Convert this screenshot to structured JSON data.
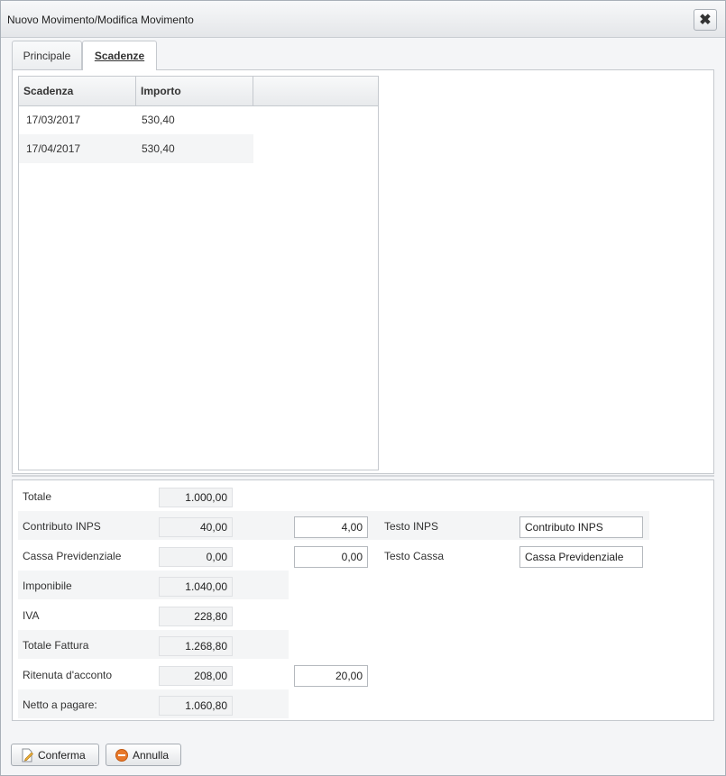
{
  "dialog": {
    "title": "Nuovo Movimento/Modifica Movimento"
  },
  "tabs": [
    {
      "label": "Principale",
      "active": false
    },
    {
      "label": "Scadenze",
      "active": true
    }
  ],
  "scadenze": {
    "headers": [
      "Scadenza",
      "Importo"
    ],
    "rows": [
      {
        "scadenza": "17/03/2017",
        "importo": "530,40"
      },
      {
        "scadenza": "17/04/2017",
        "importo": "530,40"
      }
    ]
  },
  "summary": {
    "totale": {
      "label": "Totale",
      "value": "1.000,00"
    },
    "contributo_inps": {
      "label": "Contributo INPS",
      "value": "40,00",
      "percent": "4,00",
      "text_label": "Testo INPS",
      "text_value": "Contributo INPS"
    },
    "cassa_previdenziale": {
      "label": "Cassa Previdenziale",
      "value": "0,00",
      "percent": "0,00",
      "text_label": "Testo Cassa",
      "text_value": "Cassa Previdenziale"
    },
    "imponibile": {
      "label": "Imponibile",
      "value": "1.040,00"
    },
    "iva": {
      "label": "IVA",
      "value": "228,80"
    },
    "totale_fattura": {
      "label": "Totale Fattura",
      "value": "1.268,80"
    },
    "ritenuta": {
      "label": "Ritenuta d'acconto",
      "value": "208,00",
      "percent": "20,00"
    },
    "netto": {
      "label": "Netto a pagare:",
      "value": "1.060,80"
    }
  },
  "buttons": {
    "confirm": "Conferma",
    "cancel": "Annulla"
  },
  "icons": {
    "close": "close-icon",
    "confirm": "edit-document-icon",
    "cancel": "minus-circle-icon"
  },
  "colors": {
    "cancel_icon": "#e8782a"
  }
}
